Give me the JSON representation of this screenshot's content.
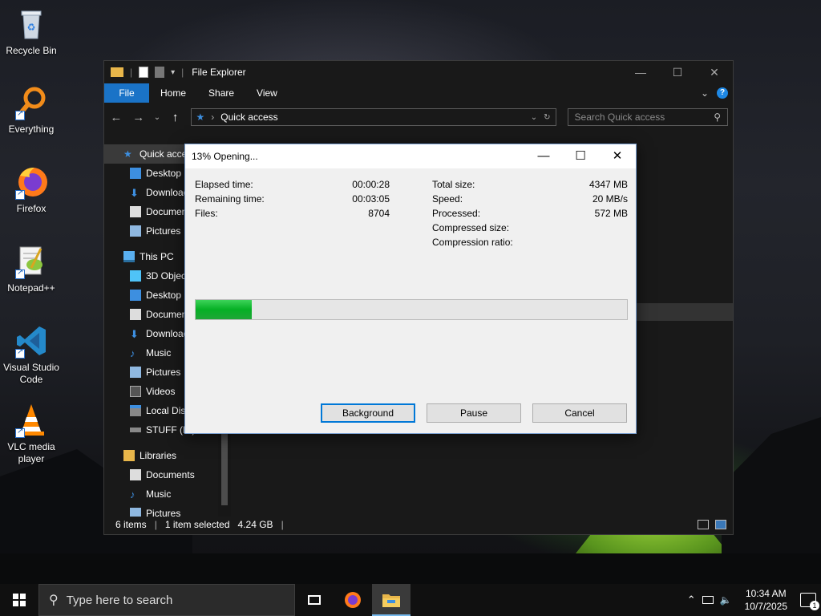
{
  "desktop": {
    "icons": [
      {
        "label": "Recycle Bin"
      },
      {
        "label": "Everything"
      },
      {
        "label": "Firefox"
      },
      {
        "label": "Notepad++"
      },
      {
        "label": "Visual Studio Code"
      },
      {
        "label": "VLC media player"
      }
    ]
  },
  "explorer": {
    "title": "File Explorer",
    "ribbon": {
      "file": "File",
      "home": "Home",
      "share": "Share",
      "view": "View"
    },
    "address": {
      "location": "Quick access"
    },
    "search": {
      "placeholder": "Search Quick access"
    },
    "nav": {
      "quick_access": "Quick access",
      "desktop": "Desktop",
      "downloads": "Downloads",
      "documents": "Documents",
      "pictures": "Pictures",
      "this_pc": "This PC",
      "objects_3d": "3D Objects",
      "pc_desktop": "Desktop",
      "pc_documents": "Documents",
      "pc_downloads": "Downloads",
      "music": "Music",
      "pc_pictures": "Pictures",
      "videos": "Videos",
      "local_disk": "Local Disk",
      "stuff": "STUFF (E:)",
      "libraries": "Libraries",
      "lib_documents": "Documents",
      "lib_music": "Music",
      "lib_pictures": "Pictures"
    },
    "status": {
      "items": "6 items",
      "selected": "1 item selected",
      "size": "4.24 GB"
    }
  },
  "dialog": {
    "title": "13% Opening...",
    "progress_fraction": 0.13,
    "stats_left": [
      {
        "label": "Elapsed time:",
        "value": "00:00:28"
      },
      {
        "label": "Remaining time:",
        "value": "00:03:05"
      },
      {
        "label": "Files:",
        "value": "8704"
      }
    ],
    "stats_right": [
      {
        "label": "Total size:",
        "value": "4347 MB"
      },
      {
        "label": "Speed:",
        "value": "20 MB/s"
      },
      {
        "label": "Processed:",
        "value": "572 MB"
      },
      {
        "label": "Compressed size:",
        "value": ""
      },
      {
        "label": "Compression ratio:",
        "value": ""
      }
    ],
    "buttons": {
      "background": "Background",
      "pause": "Pause",
      "cancel": "Cancel"
    }
  },
  "taskbar": {
    "search_placeholder": "Type here to search",
    "time": "10:34 AM",
    "date": "10/7/2025",
    "notification_count": "1"
  }
}
